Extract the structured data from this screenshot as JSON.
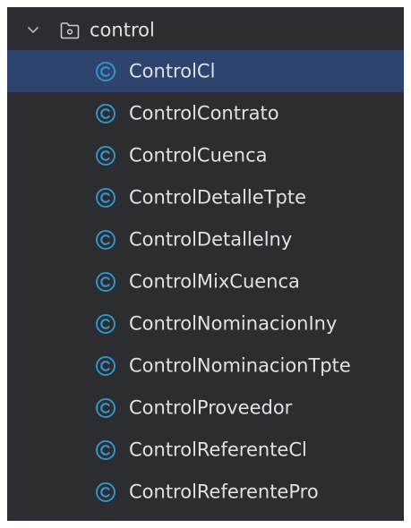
{
  "tree": {
    "folder": {
      "label": "control",
      "expanded": true,
      "chevron_icon": "chevron-down-icon",
      "folder_icon": "folder-package-icon"
    },
    "classes": [
      {
        "label": "ControlCl",
        "selected": true
      },
      {
        "label": "ControlContrato",
        "selected": false
      },
      {
        "label": "ControlCuenca",
        "selected": false
      },
      {
        "label": "ControlDetalleTpte",
        "selected": false
      },
      {
        "label": "ControlDetallelny",
        "selected": false
      },
      {
        "label": "ControlMixCuenca",
        "selected": false
      },
      {
        "label": "ControlNominacionIny",
        "selected": false
      },
      {
        "label": "ControlNominacionTpte",
        "selected": false
      },
      {
        "label": "ControlProveedor",
        "selected": false
      },
      {
        "label": "ControlReferenteCl",
        "selected": false
      },
      {
        "label": "ControlReferentePro",
        "selected": false
      }
    ],
    "class_icon": "class-c-icon"
  },
  "colors": {
    "panel_background": "#2b2d30",
    "selection": "#2e436e",
    "text": "#dfe1e5",
    "class_icon": "#3592c4",
    "folder_icon": "#c9ccd1"
  }
}
